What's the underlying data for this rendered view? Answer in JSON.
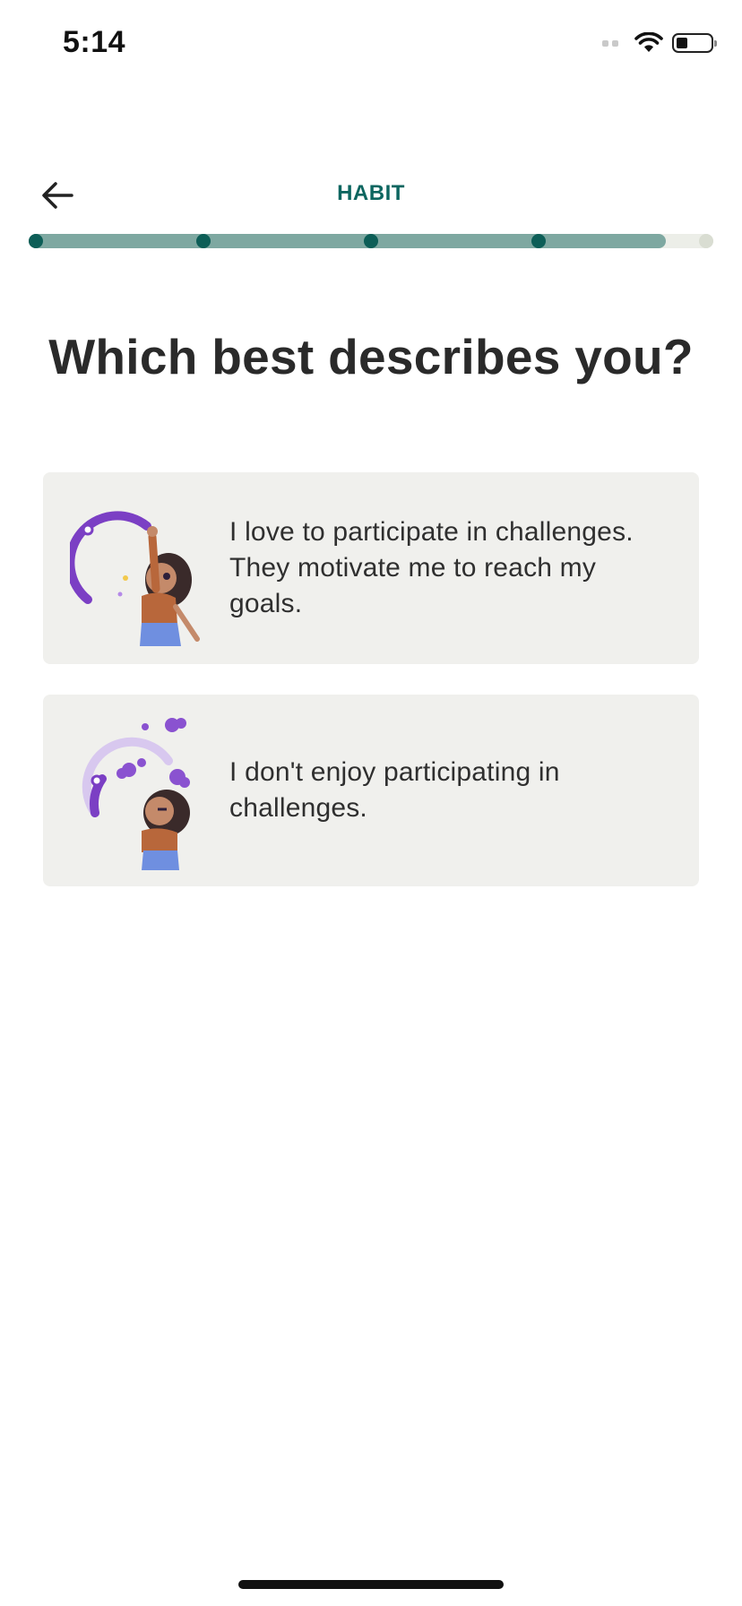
{
  "status_bar": {
    "time": "5:14"
  },
  "header": {
    "title": "HABIT",
    "back_icon": "arrow-left-icon"
  },
  "progress": {
    "fraction": 0.93,
    "steps_total": 5,
    "steps_completed": 4
  },
  "question": "Which best describes you?",
  "options": [
    {
      "text": "I love to participate in challenges. They motivate me to reach my goals.",
      "illustration": "woman-reaching-goal-illustration"
    },
    {
      "text": "I don't enjoy participating in challenges.",
      "illustration": "woman-frustrated-illustration"
    }
  ],
  "colors": {
    "accent": "#0d6660",
    "progress_fill": "#7ea8a1",
    "card_background": "#f0f0ed",
    "illustration_purple": "#7b3fc4"
  }
}
